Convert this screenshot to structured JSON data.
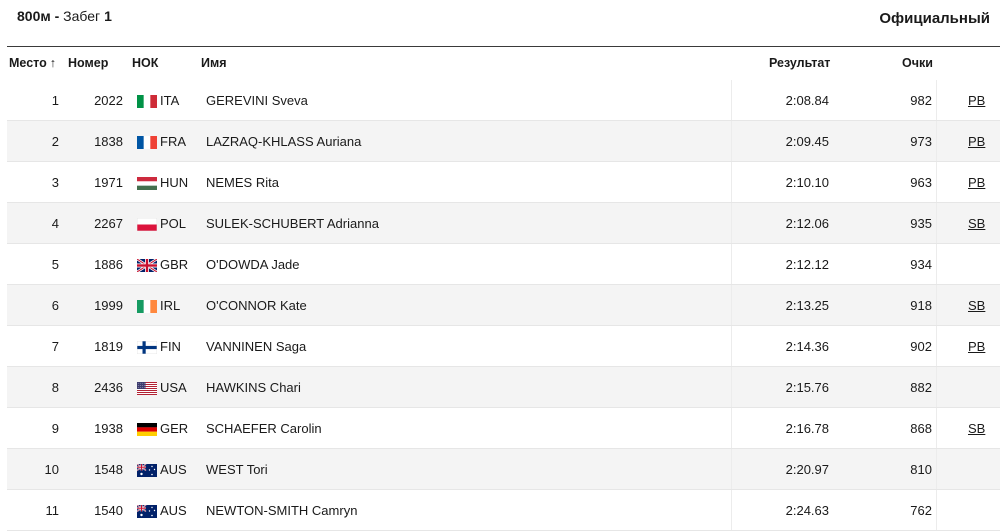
{
  "header": {
    "event": "800м",
    "dash": " - ",
    "heat_word": "Забег",
    "heat_number": "1",
    "status": "Официальный"
  },
  "columns": {
    "place": "Место",
    "sort_icon": "↑",
    "bib": "Номер",
    "noc": "НОК",
    "name": "Имя",
    "result": "Результат",
    "points": "Очки"
  },
  "rows": [
    {
      "place": "1",
      "bib": "2022",
      "noc": "ITA",
      "name": "GEREVINI Sveva",
      "result": "2:08.84",
      "points": "982",
      "record": "PB"
    },
    {
      "place": "2",
      "bib": "1838",
      "noc": "FRA",
      "name": "LAZRAQ-KHLASS Auriana",
      "result": "2:09.45",
      "points": "973",
      "record": "PB"
    },
    {
      "place": "3",
      "bib": "1971",
      "noc": "HUN",
      "name": "NEMES Rita",
      "result": "2:10.10",
      "points": "963",
      "record": "PB"
    },
    {
      "place": "4",
      "bib": "2267",
      "noc": "POL",
      "name": "SULEK-SCHUBERT Adrianna",
      "result": "2:12.06",
      "points": "935",
      "record": "SB"
    },
    {
      "place": "5",
      "bib": "1886",
      "noc": "GBR",
      "name": "O'DOWDA Jade",
      "result": "2:12.12",
      "points": "934",
      "record": ""
    },
    {
      "place": "6",
      "bib": "1999",
      "noc": "IRL",
      "name": "O'CONNOR Kate",
      "result": "2:13.25",
      "points": "918",
      "record": "SB"
    },
    {
      "place": "7",
      "bib": "1819",
      "noc": "FIN",
      "name": "VANNINEN Saga",
      "result": "2:14.36",
      "points": "902",
      "record": "PB"
    },
    {
      "place": "8",
      "bib": "2436",
      "noc": "USA",
      "name": "HAWKINS Chari",
      "result": "2:15.76",
      "points": "882",
      "record": ""
    },
    {
      "place": "9",
      "bib": "1938",
      "noc": "GER",
      "name": "SCHAEFER Carolin",
      "result": "2:16.78",
      "points": "868",
      "record": "SB"
    },
    {
      "place": "10",
      "bib": "1548",
      "noc": "AUS",
      "name": "WEST Tori",
      "result": "2:20.97",
      "points": "810",
      "record": ""
    },
    {
      "place": "11",
      "bib": "1540",
      "noc": "AUS",
      "name": "NEWTON-SMITH Camryn",
      "result": "2:24.63",
      "points": "762",
      "record": ""
    }
  ]
}
